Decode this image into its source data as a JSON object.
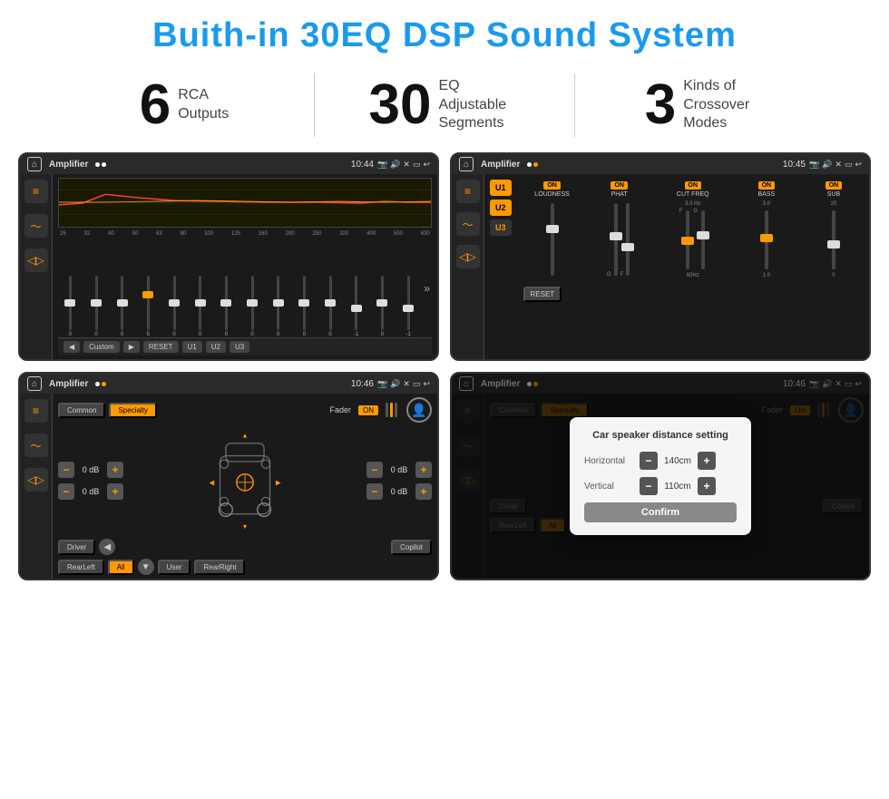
{
  "page": {
    "title": "Buith-in 30EQ DSP Sound System"
  },
  "stats": [
    {
      "number": "6",
      "text": "RCA\nOutputs"
    },
    {
      "number": "30",
      "text": "EQ Adjustable\nSegments"
    },
    {
      "number": "3",
      "text": "Kinds of\nCrossover Modes"
    }
  ],
  "screens": {
    "eq": {
      "title": "Amplifier",
      "time": "10:44",
      "freq_labels": [
        "25",
        "32",
        "40",
        "50",
        "63",
        "80",
        "100",
        "125",
        "160",
        "200",
        "250",
        "320",
        "400",
        "500",
        "630"
      ],
      "slider_values": [
        "0",
        "0",
        "0",
        "5",
        "0",
        "0",
        "0",
        "0",
        "0",
        "0",
        "0",
        "-1",
        "0",
        "-1"
      ],
      "bottom_buttons": [
        "◀",
        "Custom",
        "▶",
        "RESET",
        "U1",
        "U2",
        "U3"
      ]
    },
    "amp": {
      "title": "Amplifier",
      "time": "10:45",
      "presets": [
        "U1",
        "U2",
        "U3"
      ],
      "controls": [
        "LOUDNESS",
        "PHAT",
        "CUT FREQ",
        "BASS",
        "SUB"
      ],
      "reset": "RESET"
    },
    "fader": {
      "title": "Amplifier",
      "time": "10:46",
      "tabs": [
        "Common",
        "Specialty"
      ],
      "fader_label": "Fader",
      "on_label": "ON",
      "db_controls": [
        {
          "label": "0 dB",
          "label2": "0 dB"
        },
        {
          "label": "0 dB",
          "label2": "0 dB"
        }
      ],
      "bottom_buttons": [
        "Driver",
        "",
        "Copilot",
        "RearLeft",
        "All",
        "",
        "User",
        "RearRight"
      ]
    },
    "dialog": {
      "title": "Amplifier",
      "time": "10:46",
      "dialog_title": "Car speaker distance setting",
      "horizontal_label": "Horizontal",
      "horizontal_value": "140cm",
      "vertical_label": "Vertical",
      "vertical_value": "110cm",
      "confirm_label": "Confirm"
    }
  }
}
